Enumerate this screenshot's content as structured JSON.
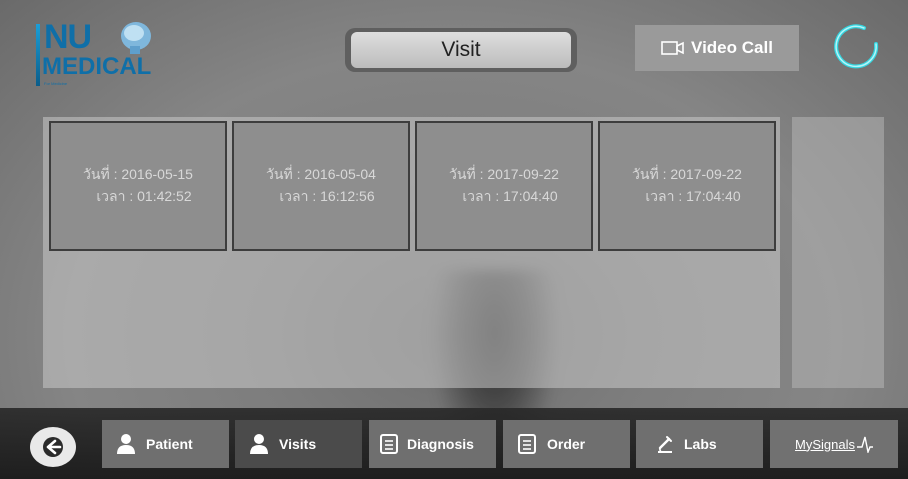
{
  "header": {
    "logo_line1": "NU",
    "logo_line2": "MEDICAL",
    "logo_tagline": "For Medicine",
    "title": "Visit",
    "video_call_label": "Video Call"
  },
  "visits": [
    {
      "date": "วันที่ : 2016-05-15",
      "time": "เวลา : 01:42:52"
    },
    {
      "date": "วันที่ : 2016-05-04",
      "time": "เวลา : 16:12:56"
    },
    {
      "date": "วันที่ : 2017-09-22",
      "time": "เวลา : 17:04:40"
    },
    {
      "date": "วันที่ : 2017-09-22",
      "time": "เวลา : 17:04:40"
    }
  ],
  "nav": {
    "patient": "Patient",
    "visits": "Visits",
    "diagnosis": "Diagnosis",
    "order": "Order",
    "labs": "Labs",
    "mysignals": "MySignals"
  },
  "icons": {
    "back": "arrow-left-icon",
    "patient": "person-icon",
    "visits": "person-icon",
    "diagnosis": "document-icon",
    "order": "document-icon",
    "labs": "microscope-icon",
    "mysignals": "pulse-icon",
    "video": "video-camera-icon",
    "spinner": "loading-ring-icon"
  },
  "colors": {
    "brand": "#0f6fa8",
    "accent": "#35d6e0"
  }
}
